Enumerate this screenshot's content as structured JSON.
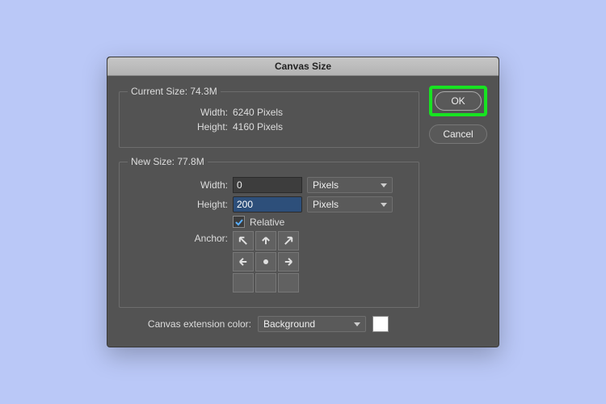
{
  "title": "Canvas Size",
  "buttons": {
    "ok": "OK",
    "cancel": "Cancel"
  },
  "current": {
    "legend": "Current Size: 74.3M",
    "width_label": "Width:",
    "width_value": "6240 Pixels",
    "height_label": "Height:",
    "height_value": "4160 Pixels"
  },
  "newsize": {
    "legend": "New Size: 77.8M",
    "width_label": "Width:",
    "width_value": "0",
    "height_label": "Height:",
    "height_value": "200",
    "unit": "Pixels",
    "relative_label": "Relative",
    "relative_checked": true,
    "anchor_label": "Anchor:"
  },
  "ext": {
    "label": "Canvas extension color:",
    "value": "Background"
  }
}
